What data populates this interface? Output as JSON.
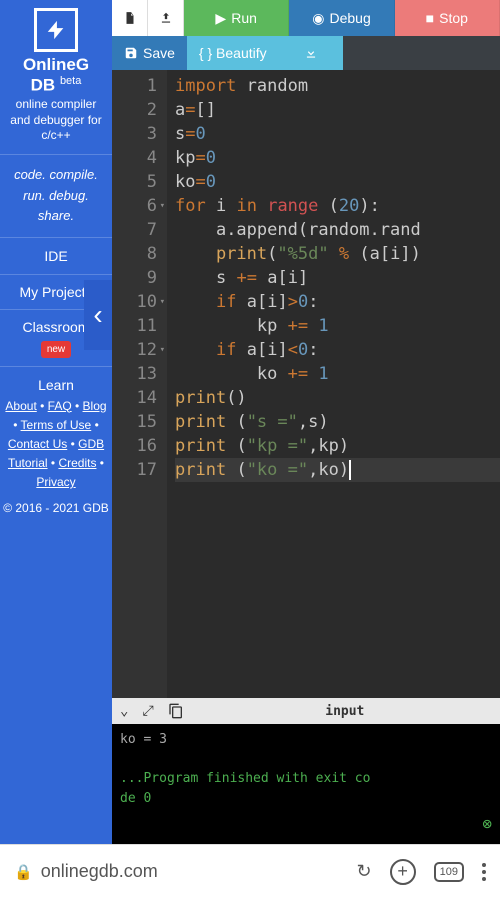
{
  "sidebar": {
    "brand_line1": "OnlineG",
    "brand_line2": "DB",
    "brand_beta": "beta",
    "tagline": "online compiler and debugger for c/c++",
    "slogan": "code. compile. run. debug. share.",
    "nav": {
      "ide": "IDE",
      "my_projects": "My Projects",
      "classroom": "Classroom",
      "new_badge": "new",
      "learn": "Learn"
    },
    "links_text": "About • FAQ • Blog • Terms of Use • Contact Us • GDB Tutorial • Credits • Privacy",
    "copyright": "© 2016 - 2021 GDB"
  },
  "toolbar": {
    "run": "Run",
    "debug": "Debug",
    "stop": "Stop",
    "save": "Save",
    "beautify": "{ } Beautify"
  },
  "editor": {
    "lines": [
      {
        "n": 1,
        "html": "<span class='kw-import'>import</span> <span class='id'>random</span>"
      },
      {
        "n": 2,
        "html": "<span class='id'>a</span><span class='op'>=</span><span class='punc'>[]</span>"
      },
      {
        "n": 3,
        "html": "<span class='id'>s</span><span class='op'>=</span><span class='num'>0</span>"
      },
      {
        "n": 4,
        "html": "<span class='id'>kp</span><span class='op'>=</span><span class='num'>0</span>"
      },
      {
        "n": 5,
        "html": "<span class='id'>ko</span><span class='op'>=</span><span class='num'>0</span>"
      },
      {
        "n": 6,
        "fold": true,
        "html": "<span class='kw-for'>for</span> <span class='id'>i</span> <span class='kw-in'>in</span> <span class='fn-range'>range</span> <span class='punc'>(</span><span class='num'>20</span><span class='punc'>):</span>"
      },
      {
        "n": 7,
        "html": "    <span class='id'>a.append</span><span class='punc'>(</span><span class='id'>random.rand</span>"
      },
      {
        "n": 8,
        "html": "    <span class='fn-print'>print</span><span class='punc'>(</span><span class='str'>\"%5d\"</span> <span class='op'>%</span> <span class='punc'>(</span><span class='id'>a</span><span class='punc'>[</span><span class='id'>i</span><span class='punc'>])</span>"
      },
      {
        "n": 9,
        "html": "    <span class='id'>s</span> <span class='op'>+=</span> <span class='id'>a</span><span class='punc'>[</span><span class='id'>i</span><span class='punc'>]</span>"
      },
      {
        "n": 10,
        "fold": true,
        "html": "    <span class='kw-if'>if</span> <span class='id'>a</span><span class='punc'>[</span><span class='id'>i</span><span class='punc'>]</span><span class='op'>&gt;</span><span class='num'>0</span><span class='punc'>:</span>"
      },
      {
        "n": 11,
        "html": "        <span class='id'>kp</span> <span class='op'>+=</span> <span class='num'>1</span>"
      },
      {
        "n": 12,
        "fold": true,
        "html": "    <span class='kw-if'>if</span> <span class='id'>a</span><span class='punc'>[</span><span class='id'>i</span><span class='punc'>]</span><span class='op'>&lt;</span><span class='num'>0</span><span class='punc'>:</span>"
      },
      {
        "n": 13,
        "html": "        <span class='id'>ko</span> <span class='op'>+=</span> <span class='num'>1</span>"
      },
      {
        "n": 14,
        "html": "<span class='fn-print'>print</span><span class='punc'>()</span>"
      },
      {
        "n": 15,
        "html": "<span class='fn-print'>print</span> <span class='punc'>(</span><span class='str'>\"s =\"</span><span class='punc'>,</span><span class='id'>s</span><span class='punc'>)</span>"
      },
      {
        "n": 16,
        "html": "<span class='fn-print'>print</span> <span class='punc'>(</span><span class='str'>\"kp =\"</span><span class='punc'>,</span><span class='id'>kp</span><span class='punc'>)</span>"
      },
      {
        "n": 17,
        "hl": true,
        "html": "<span class='fn-print'>print</span> <span class='punc'>(</span><span class='str'>\"ko =\"</span><span class='punc'>,</span><span class='id'>ko</span><span class='punc'>)</span><span class='cursor'></span>"
      }
    ]
  },
  "console": {
    "title": "input",
    "line1": "ko = 3",
    "finish_line1": "...Program finished with exit co",
    "finish_line2": "de 0"
  },
  "browser": {
    "url": "onlinegdb.com",
    "tab_count": "109"
  }
}
